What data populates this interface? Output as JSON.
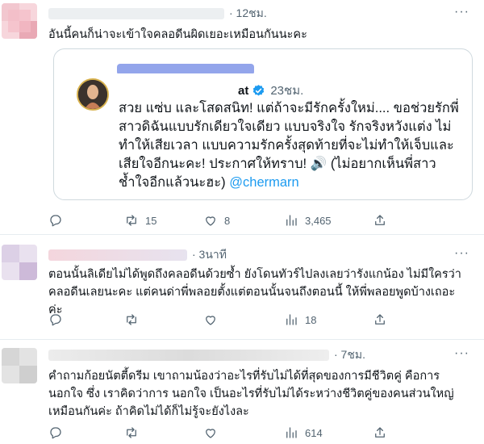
{
  "tweets": [
    {
      "time": "· 12ชม.",
      "text": "อันนี้คนก็น่าจะเข้าใจคลอดีนผิดเยอะเหมือนกันนะคะ",
      "quote": {
        "handle_visible": "at",
        "time": "23ชม.",
        "text": "สวย แซ่บ และโสดสนิท! แต่ถ้าจะมีรักครั้งใหม่.... ขอช่วยรักพี่สาวดิฉันแบบรักเดียวใจเดียว แบบจริงใจ รักจริงหวังแต่ง ไม่ทำให้เสียเวลา แบบความรักครั้งสุดท้ายที่จะไม่ทำให้เจ็บและเสียใจอีกนะคะ! ประกาศให้ทราบ! 🔊 (ไม่อยากเห็นพี่สาวช้ำใจอีกแล้วนะฮะ) ",
        "mention": "@chermarn"
      },
      "retweets": "15",
      "likes": "8",
      "views": "3,465"
    },
    {
      "time": "· 3นาที",
      "text": "ตอนนั้นลิเดียไม่ได้พูดถึงคลอดีนด้วยซ้ำ ยังโดนทัวร์ไปลงเลยว่ารังแกน้อง ไม่มีใครว่าคลอดีนเลยนะคะ แต่คนด่าพี่พลอยตั้งแต่ตอนนั้นจนถึงตอนนี้ ให้พี่พลอยพูดบ้างเถอะค่ะ",
      "retweets": "",
      "likes": "",
      "views": "18"
    },
    {
      "time": "· 7ชม.",
      "text": "คำถามก้อยนัตตี้ดรีม เขาถามน้องว่าอะไรที่รับไม่ได้ที่สุดของการมีชีวิตคู่ คือการนอกใจ ซึ่ง เราคิดว่าการ นอกใจ เป็นอะไรที่รับไม่ได้ระหว่างชีวิตคู่ของคนส่วนใหญ่เหมือนกันค่ะ ถ้าคิดไม่ได้ก็ไม่รู้จะยังไงละ",
      "retweets": "",
      "likes": "",
      "views": "614"
    }
  ],
  "icons": [
    "reply-icon",
    "retweet-icon",
    "like-icon",
    "views-icon",
    "share-icon",
    "more-icon",
    "verified-icon",
    "speaker-emoji"
  ],
  "colors": {
    "mention": "#1d9bf0",
    "verified": "#1d9bf0",
    "secondary_text": "#536471",
    "border": "#cfd9de"
  }
}
